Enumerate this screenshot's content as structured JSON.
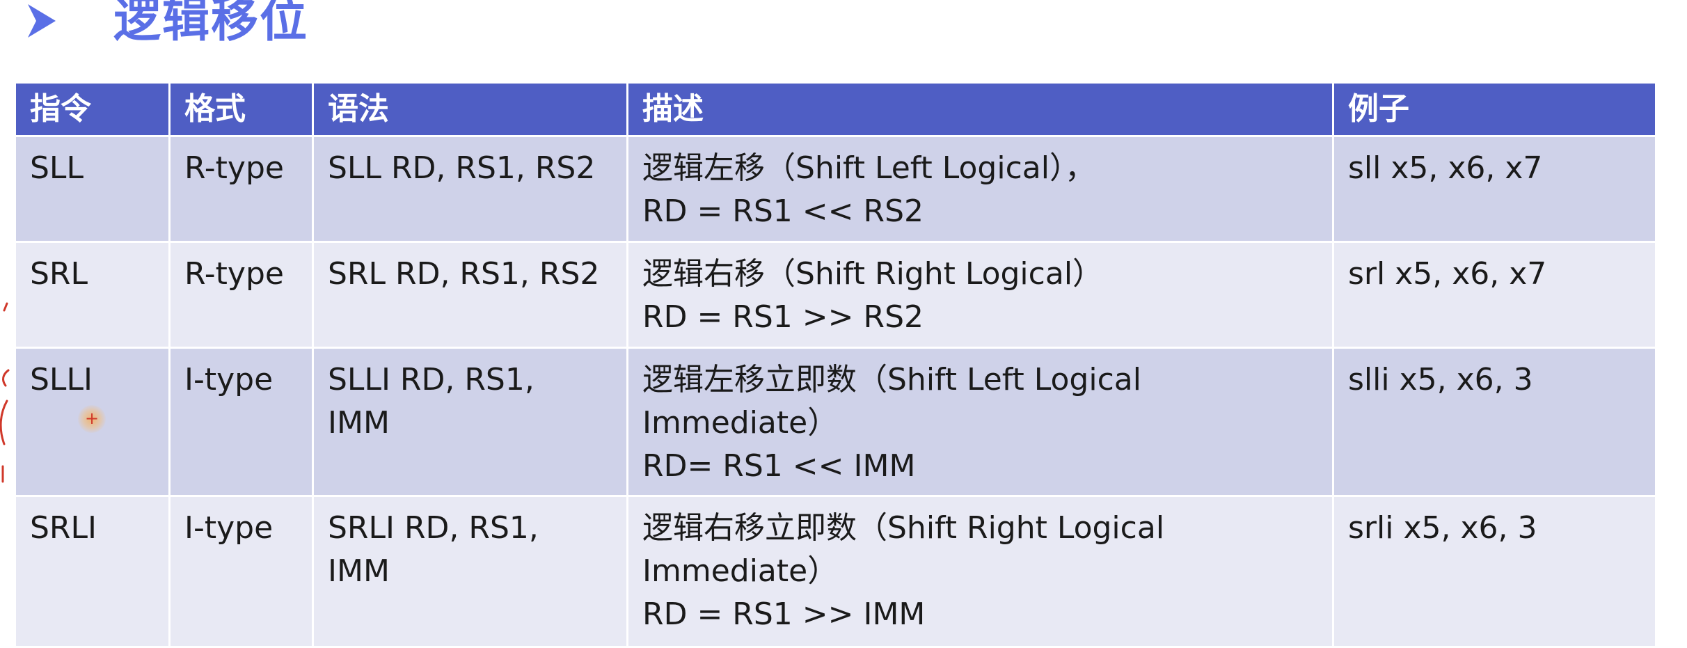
{
  "title": "逻辑移位",
  "colors": {
    "title": "#5a6fe6",
    "header_bg": "#4f5ec4",
    "row_dark": "#cfd2e9",
    "row_light": "#e8e9f4",
    "annotation": "#d0382a"
  },
  "icons": {
    "bullet": "arrowhead-bullet-icon",
    "cursor": "cursor-highlight-icon"
  },
  "table": {
    "headers": [
      "指令",
      "格式",
      "语法",
      "描述",
      "例子"
    ],
    "rows": [
      {
        "instruction": "SLL",
        "format": "R-type",
        "syntax": [
          "SLL RD, RS1, RS2"
        ],
        "description": [
          "逻辑左移（Shift Left Logical），",
          "RD = RS1 << RS2"
        ],
        "example": "sll x5, x6, x7"
      },
      {
        "instruction": "SRL",
        "format": "R-type",
        "syntax": [
          "SRL RD, RS1, RS2"
        ],
        "description": [
          "逻辑右移（Shift Right Logical）",
          "RD = RS1 >> RS2"
        ],
        "example": "srl x5, x6, x7"
      },
      {
        "instruction": "SLLI",
        "format": "I-type",
        "syntax": [
          "SLLI RD, RS1,",
          "IMM"
        ],
        "description": [
          "逻辑左移立即数（Shift Left Logical",
          "Immediate）",
          "RD= RS1 << IMM"
        ],
        "example": "slli x5, x6, 3"
      },
      {
        "instruction": "SRLI",
        "format": "I-type",
        "syntax": [
          "SRLI RD, RS1,",
          "IMM"
        ],
        "description": [
          "逻辑右移立即数（Shift Right Logical",
          "Immediate）",
          "RD = RS1 >> IMM"
        ],
        "example": "srli x5, x6, 3"
      }
    ]
  },
  "cursor_symbol": "+"
}
